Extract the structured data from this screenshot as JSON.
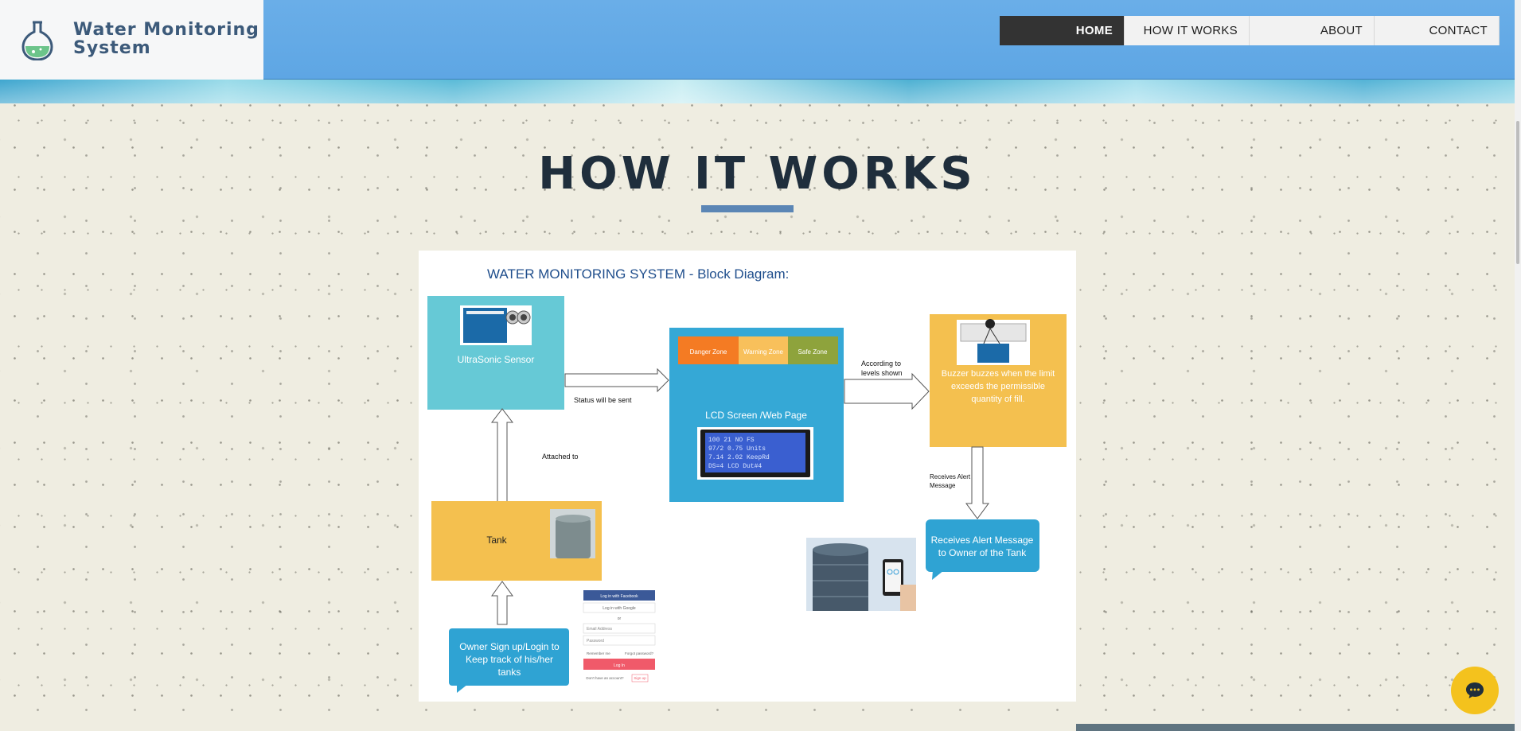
{
  "site": {
    "name_line1": "Water Monitoring",
    "name_line2": "System",
    "logo_icon": "flask-icon"
  },
  "nav": {
    "items": [
      {
        "label": "HOME",
        "active": true
      },
      {
        "label": "HOW IT WORKS",
        "active": false
      },
      {
        "label": "ABOUT",
        "active": false
      },
      {
        "label": "CONTACT",
        "active": false
      }
    ]
  },
  "section": {
    "title": "HOW IT WORKS"
  },
  "diagram": {
    "heading": "WATER MONITORING SYSTEM - Block Diagram:",
    "sensor_label": "UltraSonic Sensor",
    "lcd_label": "LCD Screen /Web Page",
    "zones": [
      "Danger Zone",
      "Warning Zone",
      "Safe Zone"
    ],
    "lcd_screen_lines": [
      "100    21  NO FS",
      "97/2  0.75  Units",
      "7.14  2.02  KeepRd",
      "DS=4  LCD  Dut#4"
    ],
    "buzzer_lines": [
      "Buzzer buzzes when the limit",
      "exceeds the permissible",
      "quantity of fill."
    ],
    "tank_label": "Tank",
    "owner_lines": [
      "Owner Sign up/Login to",
      "Keep track of his/her",
      "tanks"
    ],
    "alert_lines": [
      "Receives Alert Message",
      "to Owner of the Tank"
    ],
    "arrow_status": "Status will be sent",
    "arrow_attached": "Attached to",
    "arrow_according": [
      "According to",
      "levels shown"
    ],
    "arrow_receives": [
      "Receives Alert",
      "Message"
    ],
    "login_form": {
      "facebook": "Log in with Facebook",
      "google": "Log in with Google",
      "or": "or",
      "email": "Email Address",
      "password": "Password",
      "remember": "Remember me",
      "forgot": "Forgot password?",
      "login": "Log In",
      "signup_prompt": "Don't have an account?",
      "signup": "Sign up"
    }
  },
  "colors": {
    "header_blue": "#5ea6e4",
    "nav_active": "#333333",
    "sensor_box": "#66c9d6",
    "lcd_box": "#35a8d6",
    "orange_box": "#f4c04f",
    "danger": "#f47b23",
    "warning": "#f8c05b",
    "safe": "#8ea33c",
    "callout": "#2fa3d3",
    "chat": "#f4c21d"
  },
  "chat": {
    "icon": "chat-bubble-icon"
  }
}
